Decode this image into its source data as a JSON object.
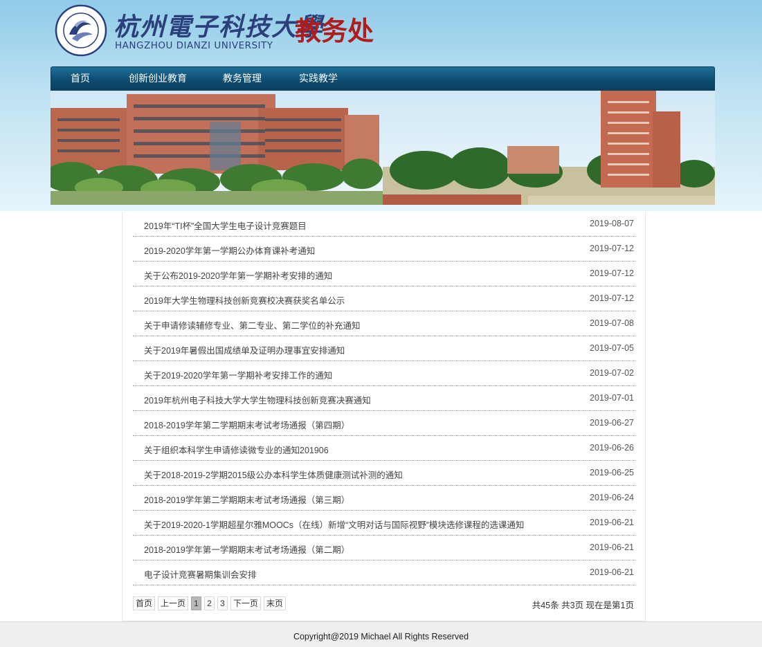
{
  "header": {
    "university_cn": "杭州電子科技大學",
    "university_en": "HANGZHOU DIANZI UNIVERSITY",
    "department": "教务处"
  },
  "nav": {
    "items": [
      {
        "label": "首页"
      },
      {
        "label": "创新创业教育"
      },
      {
        "label": "教务管理"
      },
      {
        "label": "实践教学"
      }
    ]
  },
  "news": {
    "items": [
      {
        "title": "2019年“TI杯”全国大学生电子设计竞赛题目",
        "date": "2019-08-07"
      },
      {
        "title": "2019-2020学年第一学期公办体育课补考通知",
        "date": "2019-07-12"
      },
      {
        "title": "关于公布2019-2020学年第一学期补考安排的通知",
        "date": "2019-07-12"
      },
      {
        "title": "2019年大学生物理科技创新竞赛校决赛获奖名单公示",
        "date": "2019-07-12"
      },
      {
        "title": "关于申请修读辅修专业、第二专业、第二学位的补充通知",
        "date": "2019-07-08"
      },
      {
        "title": "关于2019年暑假出国成绩单及证明办理事宜安排通知",
        "date": "2019-07-05"
      },
      {
        "title": "关于2019-2020学年第一学期补考安排工作的通知",
        "date": "2019-07-02"
      },
      {
        "title": "2019年杭州电子科技大学大学生物理科技创新竞赛决赛通知",
        "date": "2019-07-01"
      },
      {
        "title": "2018-2019学年第二学期期末考试考场通报（第四期）",
        "date": "2019-06-27"
      },
      {
        "title": "关于组织本科学生申请修读微专业的通知201906",
        "date": "2019-06-26"
      },
      {
        "title": "关于2018-2019-2学期2015级公办本科学生体质健康测试补测的通知",
        "date": "2019-06-25"
      },
      {
        "title": "2018-2019学年第二学期期末考试考场通报（第三期）",
        "date": "2019-06-24"
      },
      {
        "title": "关于2019-2020-1学期超星尔雅MOOCs（在线）新增“文明对话与国际视野”模块选修课程的选课通知",
        "date": "2019-06-21"
      },
      {
        "title": "2018-2019学年第一学期期末考试考场通报（第二期）",
        "date": "2019-06-21"
      },
      {
        "title": "电子设计竞赛暑期集训会安排",
        "date": "2019-06-21"
      }
    ]
  },
  "pager": {
    "first": "首页",
    "prev": "上一页",
    "pages": [
      "1",
      "2",
      "3"
    ],
    "current": "1",
    "next": "下一页",
    "last": "末页",
    "info": "共45条 共3页 现在是第1页"
  },
  "footer": {
    "copyright": "Copyright@2019 Michael All Rights Reserved"
  },
  "colors": {
    "nav_bg": "#0e4d72",
    "department_red": "#b01c1c",
    "university_blue": "#2b3f7a",
    "pager_active": "#b9b9b9"
  }
}
